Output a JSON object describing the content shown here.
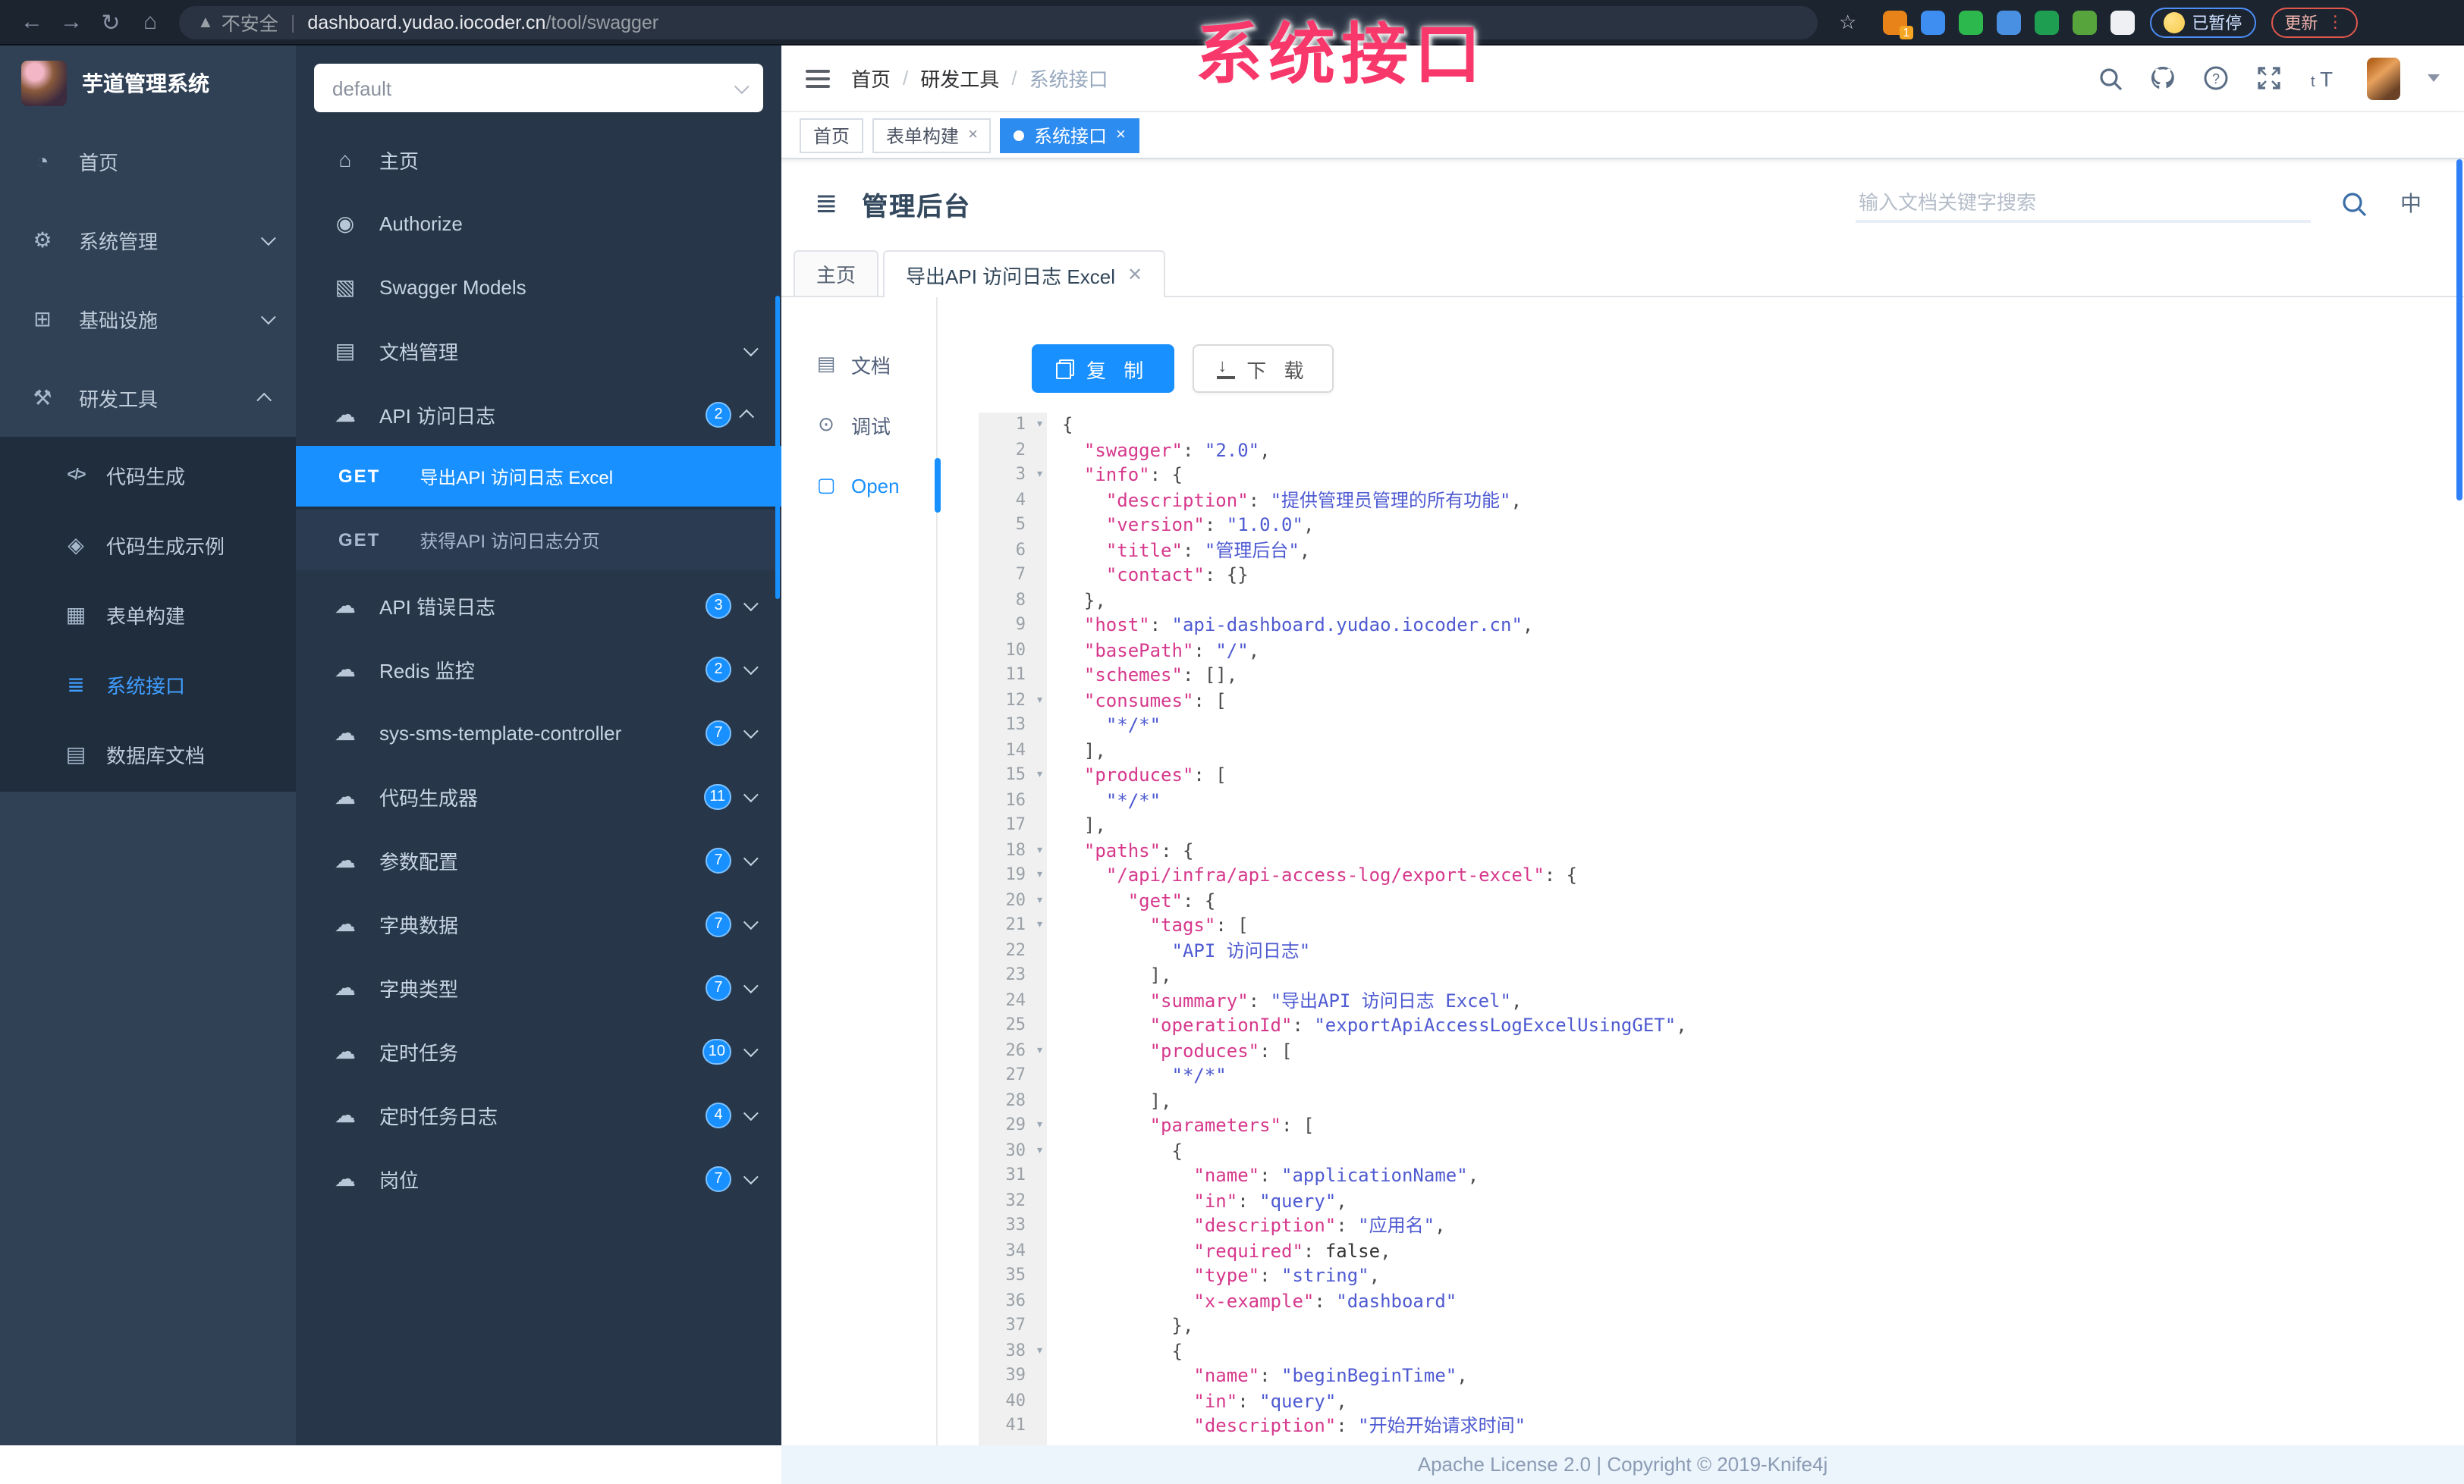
{
  "browser": {
    "security_label": "不安全",
    "url_host": "dashboard.yudao.iocoder.cn",
    "url_path": "/tool/swagger",
    "extensions": [
      {
        "name": "extension-orange",
        "color": "#e8831a",
        "badge": "1"
      },
      {
        "name": "extension-blue-pin",
        "color": "#3d8ef0",
        "badge": ""
      },
      {
        "name": "extension-green-shield",
        "color": "#2db84d",
        "badge": ""
      },
      {
        "name": "extension-blue-grid",
        "color": "#4a90e2",
        "badge": ""
      },
      {
        "name": "extension-green-translate",
        "color": "#1e9e50",
        "badge": ""
      },
      {
        "name": "extension-green-leaf",
        "color": "#57a33c",
        "badge": ""
      },
      {
        "name": "extension-white-paw",
        "color": "#eef0f4",
        "badge": ""
      }
    ],
    "paused_badge": "已暂停",
    "update_button": "更新"
  },
  "overlay": {
    "text": "系统接口",
    "color": "#f8376b"
  },
  "sidebar": {
    "logo_title": "芋道管理系统",
    "items": [
      {
        "label": "首页",
        "icon": "dashboard-icon",
        "chevron": ""
      },
      {
        "label": "系统管理",
        "icon": "gear-icon",
        "chevron": "down"
      },
      {
        "label": "基础设施",
        "icon": "infra-icon",
        "chevron": "down"
      },
      {
        "label": "研发工具",
        "icon": "tool-icon",
        "chevron": "up"
      }
    ],
    "subitems": [
      {
        "label": "代码生成",
        "icon": "code-icon",
        "active": false
      },
      {
        "label": "代码生成示例",
        "icon": "example-icon",
        "active": false
      },
      {
        "label": "表单构建",
        "icon": "form-icon",
        "active": false
      },
      {
        "label": "系统接口",
        "icon": "api-icon",
        "active": true
      },
      {
        "label": "数据库文档",
        "icon": "db-icon",
        "active": false
      }
    ]
  },
  "swagger_nav": {
    "group_select_value": "default",
    "items": [
      {
        "label": "主页",
        "icon": "home-icon",
        "badge": "",
        "chevron": ""
      },
      {
        "label": "Authorize",
        "icon": "lock-icon",
        "badge": "",
        "chevron": ""
      },
      {
        "label": "Swagger Models",
        "icon": "models-icon",
        "badge": "",
        "chevron": ""
      },
      {
        "label": "文档管理",
        "icon": "docmgr-icon",
        "badge": "",
        "chevron": "down"
      },
      {
        "label": "API 访问日志",
        "icon": "cloud-icon",
        "badge": "2",
        "chevron": "up",
        "children": [
          {
            "method": "GET",
            "label": "导出API 访问日志 Excel",
            "active": true
          },
          {
            "method": "GET",
            "label": "获得API 访问日志分页",
            "active": false
          }
        ]
      },
      {
        "label": "API 错误日志",
        "icon": "cloud-icon",
        "badge": "3",
        "chevron": "down"
      },
      {
        "label": "Redis 监控",
        "icon": "cloud-icon",
        "badge": "2",
        "chevron": "down"
      },
      {
        "label": "sys-sms-template-controller",
        "icon": "cloud-icon",
        "badge": "7",
        "chevron": "down"
      },
      {
        "label": "代码生成器",
        "icon": "cloud-icon",
        "badge": "11",
        "chevron": "down"
      },
      {
        "label": "参数配置",
        "icon": "cloud-icon",
        "badge": "7",
        "chevron": "down"
      },
      {
        "label": "字典数据",
        "icon": "cloud-icon",
        "badge": "7",
        "chevron": "down"
      },
      {
        "label": "字典类型",
        "icon": "cloud-icon",
        "badge": "7",
        "chevron": "down"
      },
      {
        "label": "定时任务",
        "icon": "cloud-icon",
        "badge": "10",
        "chevron": "down"
      },
      {
        "label": "定时任务日志",
        "icon": "cloud-icon",
        "badge": "4",
        "chevron": "down"
      },
      {
        "label": "岗位",
        "icon": "cloud-icon",
        "badge": "7",
        "chevron": "down"
      }
    ]
  },
  "topbar": {
    "breadcrumb": [
      "首页",
      "研发工具",
      "系统接口"
    ]
  },
  "tags_view": [
    {
      "label": "首页",
      "closable": false,
      "active": false
    },
    {
      "label": "表单构建",
      "closable": true,
      "active": false
    },
    {
      "label": "系统接口",
      "closable": true,
      "active": true
    }
  ],
  "doc_header": {
    "title": "管理后台",
    "search_placeholder": "输入文档关键字搜索",
    "lang_label": "中"
  },
  "doc_tabs": [
    {
      "label": "主页",
      "closable": false,
      "active": false
    },
    {
      "label": "导出API 访问日志 Excel",
      "closable": true,
      "active": true
    }
  ],
  "doc_nav": [
    {
      "label": "文档",
      "icon": "doc-icon",
      "active": false
    },
    {
      "label": "调试",
      "icon": "debug-icon",
      "active": false
    },
    {
      "label": "Open",
      "icon": "open-file-icon",
      "active": true
    }
  ],
  "toolbar": {
    "copy_label": "复 制",
    "download_label": "下 载"
  },
  "editor": {
    "lines": [
      {
        "fold": true,
        "tokens": [
          [
            "p",
            "{"
          ]
        ]
      },
      {
        "fold": false,
        "tokens": [
          [
            "p",
            "  "
          ],
          [
            "k",
            "\"swagger\""
          ],
          [
            "p",
            ": "
          ],
          [
            "v",
            "\"2.0\""
          ],
          [
            "p",
            ","
          ]
        ]
      },
      {
        "fold": true,
        "tokens": [
          [
            "p",
            "  "
          ],
          [
            "k",
            "\"info\""
          ],
          [
            "p",
            ": {"
          ]
        ]
      },
      {
        "fold": false,
        "tokens": [
          [
            "p",
            "    "
          ],
          [
            "k",
            "\"description\""
          ],
          [
            "p",
            ": "
          ],
          [
            "v",
            "\"提供管理员管理的所有功能\""
          ],
          [
            "p",
            ","
          ]
        ]
      },
      {
        "fold": false,
        "tokens": [
          [
            "p",
            "    "
          ],
          [
            "k",
            "\"version\""
          ],
          [
            "p",
            ": "
          ],
          [
            "v",
            "\"1.0.0\""
          ],
          [
            "p",
            ","
          ]
        ]
      },
      {
        "fold": false,
        "tokens": [
          [
            "p",
            "    "
          ],
          [
            "k",
            "\"title\""
          ],
          [
            "p",
            ": "
          ],
          [
            "v",
            "\"管理后台\""
          ],
          [
            "p",
            ","
          ]
        ]
      },
      {
        "fold": false,
        "tokens": [
          [
            "p",
            "    "
          ],
          [
            "k",
            "\"contact\""
          ],
          [
            "p",
            ": {}"
          ]
        ]
      },
      {
        "fold": false,
        "tokens": [
          [
            "p",
            "  },"
          ]
        ]
      },
      {
        "fold": false,
        "tokens": [
          [
            "p",
            "  "
          ],
          [
            "k",
            "\"host\""
          ],
          [
            "p",
            ": "
          ],
          [
            "v",
            "\"api-dashboard.yudao.iocoder.cn\""
          ],
          [
            "p",
            ","
          ]
        ]
      },
      {
        "fold": false,
        "tokens": [
          [
            "p",
            "  "
          ],
          [
            "k",
            "\"basePath\""
          ],
          [
            "p",
            ": "
          ],
          [
            "v",
            "\"/\""
          ],
          [
            "p",
            ","
          ]
        ]
      },
      {
        "fold": false,
        "tokens": [
          [
            "p",
            "  "
          ],
          [
            "k",
            "\"schemes\""
          ],
          [
            "p",
            ": [],"
          ]
        ]
      },
      {
        "fold": true,
        "tokens": [
          [
            "p",
            "  "
          ],
          [
            "k",
            "\"consumes\""
          ],
          [
            "p",
            ": ["
          ]
        ]
      },
      {
        "fold": false,
        "tokens": [
          [
            "p",
            "    "
          ],
          [
            "v",
            "\"*/*\""
          ]
        ]
      },
      {
        "fold": false,
        "tokens": [
          [
            "p",
            "  ],"
          ]
        ]
      },
      {
        "fold": true,
        "tokens": [
          [
            "p",
            "  "
          ],
          [
            "k",
            "\"produces\""
          ],
          [
            "p",
            ": ["
          ]
        ]
      },
      {
        "fold": false,
        "tokens": [
          [
            "p",
            "    "
          ],
          [
            "v",
            "\"*/*\""
          ]
        ]
      },
      {
        "fold": false,
        "tokens": [
          [
            "p",
            "  ],"
          ]
        ]
      },
      {
        "fold": true,
        "tokens": [
          [
            "p",
            "  "
          ],
          [
            "k",
            "\"paths\""
          ],
          [
            "p",
            ": {"
          ]
        ]
      },
      {
        "fold": true,
        "tokens": [
          [
            "p",
            "    "
          ],
          [
            "k",
            "\"/api/infra/api-access-log/export-excel\""
          ],
          [
            "p",
            ": {"
          ]
        ]
      },
      {
        "fold": true,
        "tokens": [
          [
            "p",
            "      "
          ],
          [
            "k",
            "\"get\""
          ],
          [
            "p",
            ": {"
          ]
        ]
      },
      {
        "fold": true,
        "tokens": [
          [
            "p",
            "        "
          ],
          [
            "k",
            "\"tags\""
          ],
          [
            "p",
            ": ["
          ]
        ]
      },
      {
        "fold": false,
        "tokens": [
          [
            "p",
            "          "
          ],
          [
            "v",
            "\"API 访问日志\""
          ]
        ]
      },
      {
        "fold": false,
        "tokens": [
          [
            "p",
            "        ],"
          ]
        ]
      },
      {
        "fold": false,
        "tokens": [
          [
            "p",
            "        "
          ],
          [
            "k",
            "\"summary\""
          ],
          [
            "p",
            ": "
          ],
          [
            "v",
            "\"导出API 访问日志 Excel\""
          ],
          [
            "p",
            ","
          ]
        ]
      },
      {
        "fold": false,
        "tokens": [
          [
            "p",
            "        "
          ],
          [
            "k",
            "\"operationId\""
          ],
          [
            "p",
            ": "
          ],
          [
            "v",
            "\"exportApiAccessLogExcelUsingGET\""
          ],
          [
            "p",
            ","
          ]
        ]
      },
      {
        "fold": true,
        "tokens": [
          [
            "p",
            "        "
          ],
          [
            "k",
            "\"produces\""
          ],
          [
            "p",
            ": ["
          ]
        ]
      },
      {
        "fold": false,
        "tokens": [
          [
            "p",
            "          "
          ],
          [
            "v",
            "\"*/*\""
          ]
        ]
      },
      {
        "fold": false,
        "tokens": [
          [
            "p",
            "        ],"
          ]
        ]
      },
      {
        "fold": true,
        "tokens": [
          [
            "p",
            "        "
          ],
          [
            "k",
            "\"parameters\""
          ],
          [
            "p",
            ": ["
          ]
        ]
      },
      {
        "fold": true,
        "tokens": [
          [
            "p",
            "          {"
          ]
        ]
      },
      {
        "fold": false,
        "tokens": [
          [
            "p",
            "            "
          ],
          [
            "k",
            "\"name\""
          ],
          [
            "p",
            ": "
          ],
          [
            "v",
            "\"applicationName\""
          ],
          [
            "p",
            ","
          ]
        ]
      },
      {
        "fold": false,
        "tokens": [
          [
            "p",
            "            "
          ],
          [
            "k",
            "\"in\""
          ],
          [
            "p",
            ": "
          ],
          [
            "v",
            "\"query\""
          ],
          [
            "p",
            ","
          ]
        ]
      },
      {
        "fold": false,
        "tokens": [
          [
            "p",
            "            "
          ],
          [
            "k",
            "\"description\""
          ],
          [
            "p",
            ": "
          ],
          [
            "v",
            "\"应用名\""
          ],
          [
            "p",
            ","
          ]
        ]
      },
      {
        "fold": false,
        "tokens": [
          [
            "p",
            "            "
          ],
          [
            "k",
            "\"required\""
          ],
          [
            "p",
            ": "
          ],
          [
            "b",
            "false"
          ],
          [
            "p",
            ","
          ]
        ]
      },
      {
        "fold": false,
        "tokens": [
          [
            "p",
            "            "
          ],
          [
            "k",
            "\"type\""
          ],
          [
            "p",
            ": "
          ],
          [
            "v",
            "\"string\""
          ],
          [
            "p",
            ","
          ]
        ]
      },
      {
        "fold": false,
        "tokens": [
          [
            "p",
            "            "
          ],
          [
            "k",
            "\"x-example\""
          ],
          [
            "p",
            ": "
          ],
          [
            "v",
            "\"dashboard\""
          ]
        ]
      },
      {
        "fold": false,
        "tokens": [
          [
            "p",
            "          },"
          ]
        ]
      },
      {
        "fold": true,
        "tokens": [
          [
            "p",
            "          {"
          ]
        ]
      },
      {
        "fold": false,
        "tokens": [
          [
            "p",
            "            "
          ],
          [
            "k",
            "\"name\""
          ],
          [
            "p",
            ": "
          ],
          [
            "v",
            "\"beginBeginTime\""
          ],
          [
            "p",
            ","
          ]
        ]
      },
      {
        "fold": false,
        "tokens": [
          [
            "p",
            "            "
          ],
          [
            "k",
            "\"in\""
          ],
          [
            "p",
            ": "
          ],
          [
            "v",
            "\"query\""
          ],
          [
            "p",
            ","
          ]
        ]
      },
      {
        "fold": false,
        "tokens": [
          [
            "p",
            "            "
          ],
          [
            "k",
            "\"description\""
          ],
          [
            "p",
            ": "
          ],
          [
            "v",
            "\"开始开始请求时间\""
          ]
        ]
      }
    ]
  },
  "footer": {
    "text": "Apache License 2.0 | Copyright © 2019-Knife4j"
  }
}
